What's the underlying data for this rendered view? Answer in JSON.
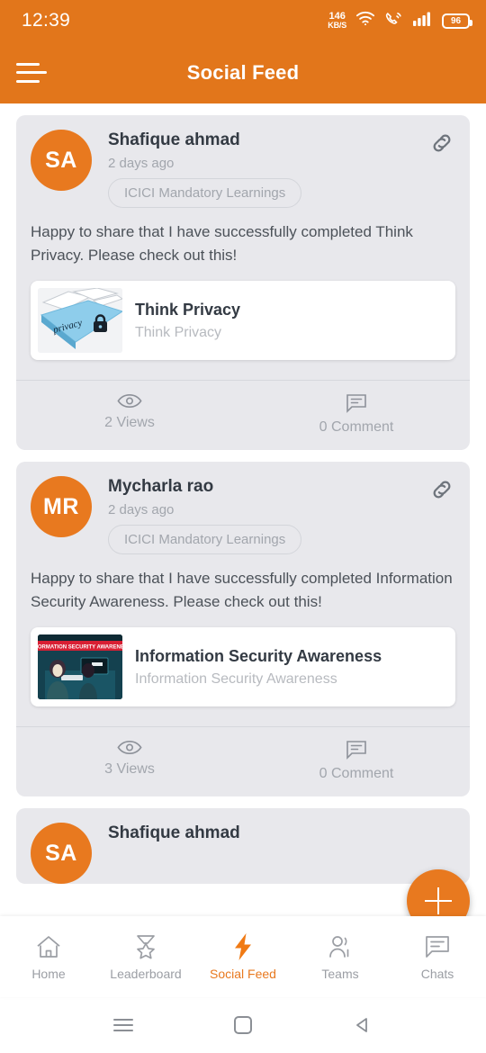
{
  "status_bar": {
    "time": "12:39",
    "net_speed_value": "146",
    "net_speed_unit": "KB/S",
    "battery_level": "96",
    "icons": [
      "wifi-icon",
      "call-signal-icon",
      "cellular-signal-icon",
      "battery-icon"
    ]
  },
  "header": {
    "title": "Social Feed",
    "menu_icon": "hamburger-menu-icon",
    "background_color": "#e2761b"
  },
  "theme": {
    "accent": "#e8791f",
    "card_background": "#e8e8ec",
    "page_background": "#ffffff",
    "muted_text": "#a2a6ad"
  },
  "feed": {
    "posts": [
      {
        "avatar_initials": "SA",
        "author": "Shafique ahmad",
        "time": "2 days ago",
        "tag": "ICICI Mandatory Learnings",
        "link_icon": "link-icon",
        "text": "Happy to share that I have successfully completed Think Privacy. Please check out this!",
        "attachment": {
          "thumbnail": "privacy-keyboard-thumbnail",
          "thumbnail_caption": "privacy",
          "title": "Think Privacy",
          "subtitle": "Think Privacy"
        },
        "views_label": "2 Views",
        "comments_label": "0 Comment"
      },
      {
        "avatar_initials": "MR",
        "author": "Mycharla rao",
        "time": "2 days ago",
        "tag": "ICICI Mandatory Learnings",
        "link_icon": "link-icon",
        "text": "Happy to share that I have successfully completed Information Security Awareness. Please check out this!",
        "attachment": {
          "thumbnail": "information-security-awareness-thumbnail",
          "thumbnail_caption": "INFORMATION SECURITY AWARENESS",
          "title": "Information Security Awareness",
          "subtitle": "Information Security Awareness"
        },
        "views_label": "3 Views",
        "comments_label": "0 Comment"
      },
      {
        "avatar_initials": "SA",
        "author": "Shafique ahmad"
      }
    ]
  },
  "fab": {
    "icon": "plus-icon",
    "label": "Create post"
  },
  "bottom_nav": {
    "items": [
      {
        "label": "Home",
        "icon": "home-icon",
        "active": false
      },
      {
        "label": "Leaderboard",
        "icon": "medal-star-icon",
        "active": false
      },
      {
        "label": "Social Feed",
        "icon": "lightning-bolt-icon",
        "active": true
      },
      {
        "label": "Teams",
        "icon": "people-icon",
        "active": false
      },
      {
        "label": "Chats",
        "icon": "chat-bubble-icon",
        "active": false
      }
    ]
  },
  "system_nav": {
    "recents": "recents-icon",
    "home": "home-square-icon",
    "back": "back-triangle-icon"
  }
}
